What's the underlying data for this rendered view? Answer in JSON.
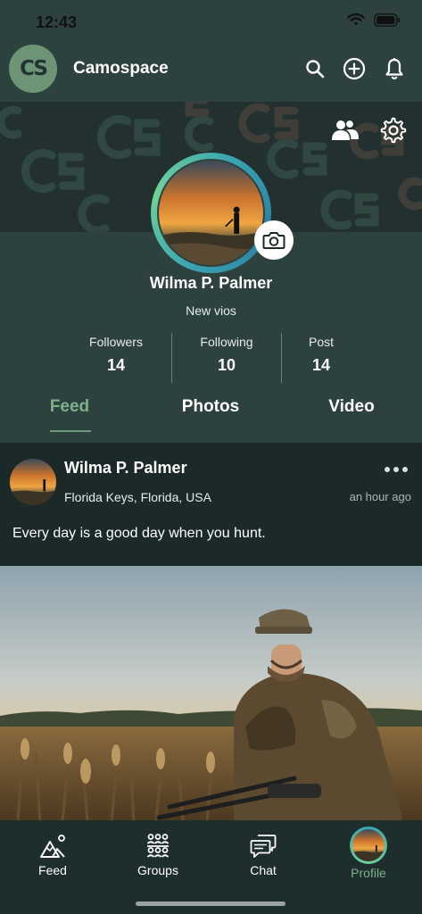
{
  "status_bar": {
    "time": "12:43"
  },
  "header": {
    "logo_text": "CS",
    "title": "Camospace",
    "icons": [
      "search-icon",
      "add-circle-icon",
      "bell-icon"
    ]
  },
  "cover": {
    "icons": [
      "users-icon",
      "gear-icon"
    ]
  },
  "profile": {
    "name": "Wilma P. Palmer",
    "bio": "New vios",
    "stats": [
      {
        "label": "Followers",
        "value": "14"
      },
      {
        "label": "Following",
        "value": "10"
      },
      {
        "label": "Post",
        "value": "14"
      }
    ]
  },
  "tabs": [
    {
      "label": "Feed",
      "active": true
    },
    {
      "label": "Photos",
      "active": false
    },
    {
      "label": "Video",
      "active": false
    }
  ],
  "post": {
    "author": "Wilma P. Palmer",
    "location": "Florida Keys, Florida, USA",
    "time": "an hour ago",
    "text": "Every day is a good day when you hunt."
  },
  "bottom_nav": [
    {
      "label": "Feed",
      "icon": "mountain-icon",
      "active": false
    },
    {
      "label": "Groups",
      "icon": "groups-icon",
      "active": false
    },
    {
      "label": "Chat",
      "icon": "chat-icon",
      "active": false
    },
    {
      "label": "Profile",
      "icon": "avatar",
      "active": true
    }
  ],
  "colors": {
    "background": "#2d423f",
    "accent": "#7fb08a",
    "post_bg": "#1b2a29",
    "nav_bg": "#1d2e2c"
  }
}
